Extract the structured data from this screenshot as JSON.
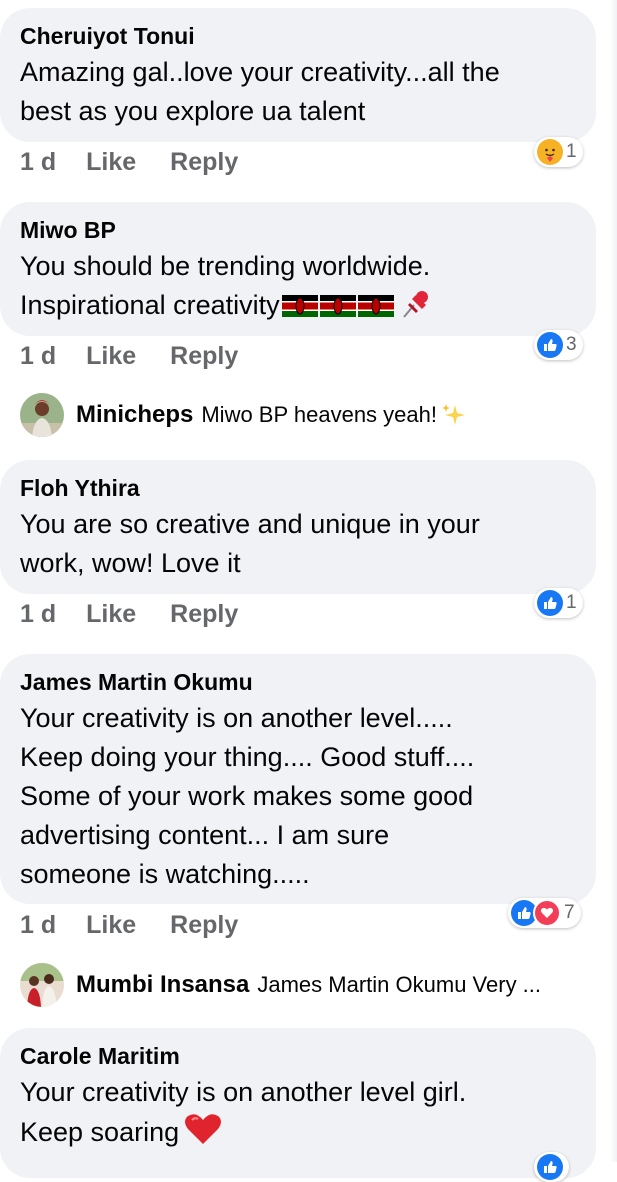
{
  "comments": [
    {
      "author": "Cheruiyot Tonui",
      "lines": [
        "Amazing gal..love your creativity...all the",
        "best as you explore ua talent"
      ],
      "time": "1 d",
      "like_label": "Like",
      "reply_label": "Reply",
      "reaction_icons": [
        "care-icon"
      ],
      "reaction_count": "1"
    },
    {
      "author": "Miwo BP",
      "lines": [
        "You should be trending worldwide.",
        "Inspirational creativity"
      ],
      "line2_emojis": [
        "kenya-flag-icon",
        "kenya-flag-icon",
        "kenya-flag-icon",
        "pushpin-icon"
      ],
      "time": "1 d",
      "like_label": "Like",
      "reply_label": "Reply",
      "reaction_icons": [
        "like-icon"
      ],
      "reaction_count": "3"
    },
    {
      "author": "Floh Ythira",
      "lines": [
        "You are so creative and unique in your",
        "work, wow! Love it"
      ],
      "time": "1 d",
      "like_label": "Like",
      "reply_label": "Reply",
      "reaction_icons": [
        "like-icon"
      ],
      "reaction_count": "1"
    },
    {
      "author": "James Martin Okumu",
      "lines": [
        "Your creativity is on another level.....",
        "Keep doing your thing.... Good stuff....",
        "Some of your work makes some good",
        "advertising content... I am sure",
        "someone is watching....."
      ],
      "time": "1 d",
      "like_label": "Like",
      "reply_label": "Reply",
      "reaction_icons": [
        "like-icon",
        "love-icon"
      ],
      "reaction_count": "7"
    },
    {
      "author": "Carole Maritim",
      "lines": [
        "Your creativity is on another level girl.",
        "Keep soaring"
      ],
      "line2_emojis": [
        "red-heart-icon"
      ],
      "reaction_icons": [
        "like-icon"
      ]
    }
  ],
  "replies": [
    {
      "author": "Minicheps",
      "text": "Miwo BP heavens yeah!",
      "emoji": "sparkles-icon"
    },
    {
      "author": "Mumbi Insansa",
      "text": "James Martin Okumu Very ..."
    }
  ],
  "colors": {
    "bubble": "#f0f2f5",
    "meta_text": "#65676b",
    "like_blue": "#1877f2",
    "love_red": "#f33e58"
  }
}
